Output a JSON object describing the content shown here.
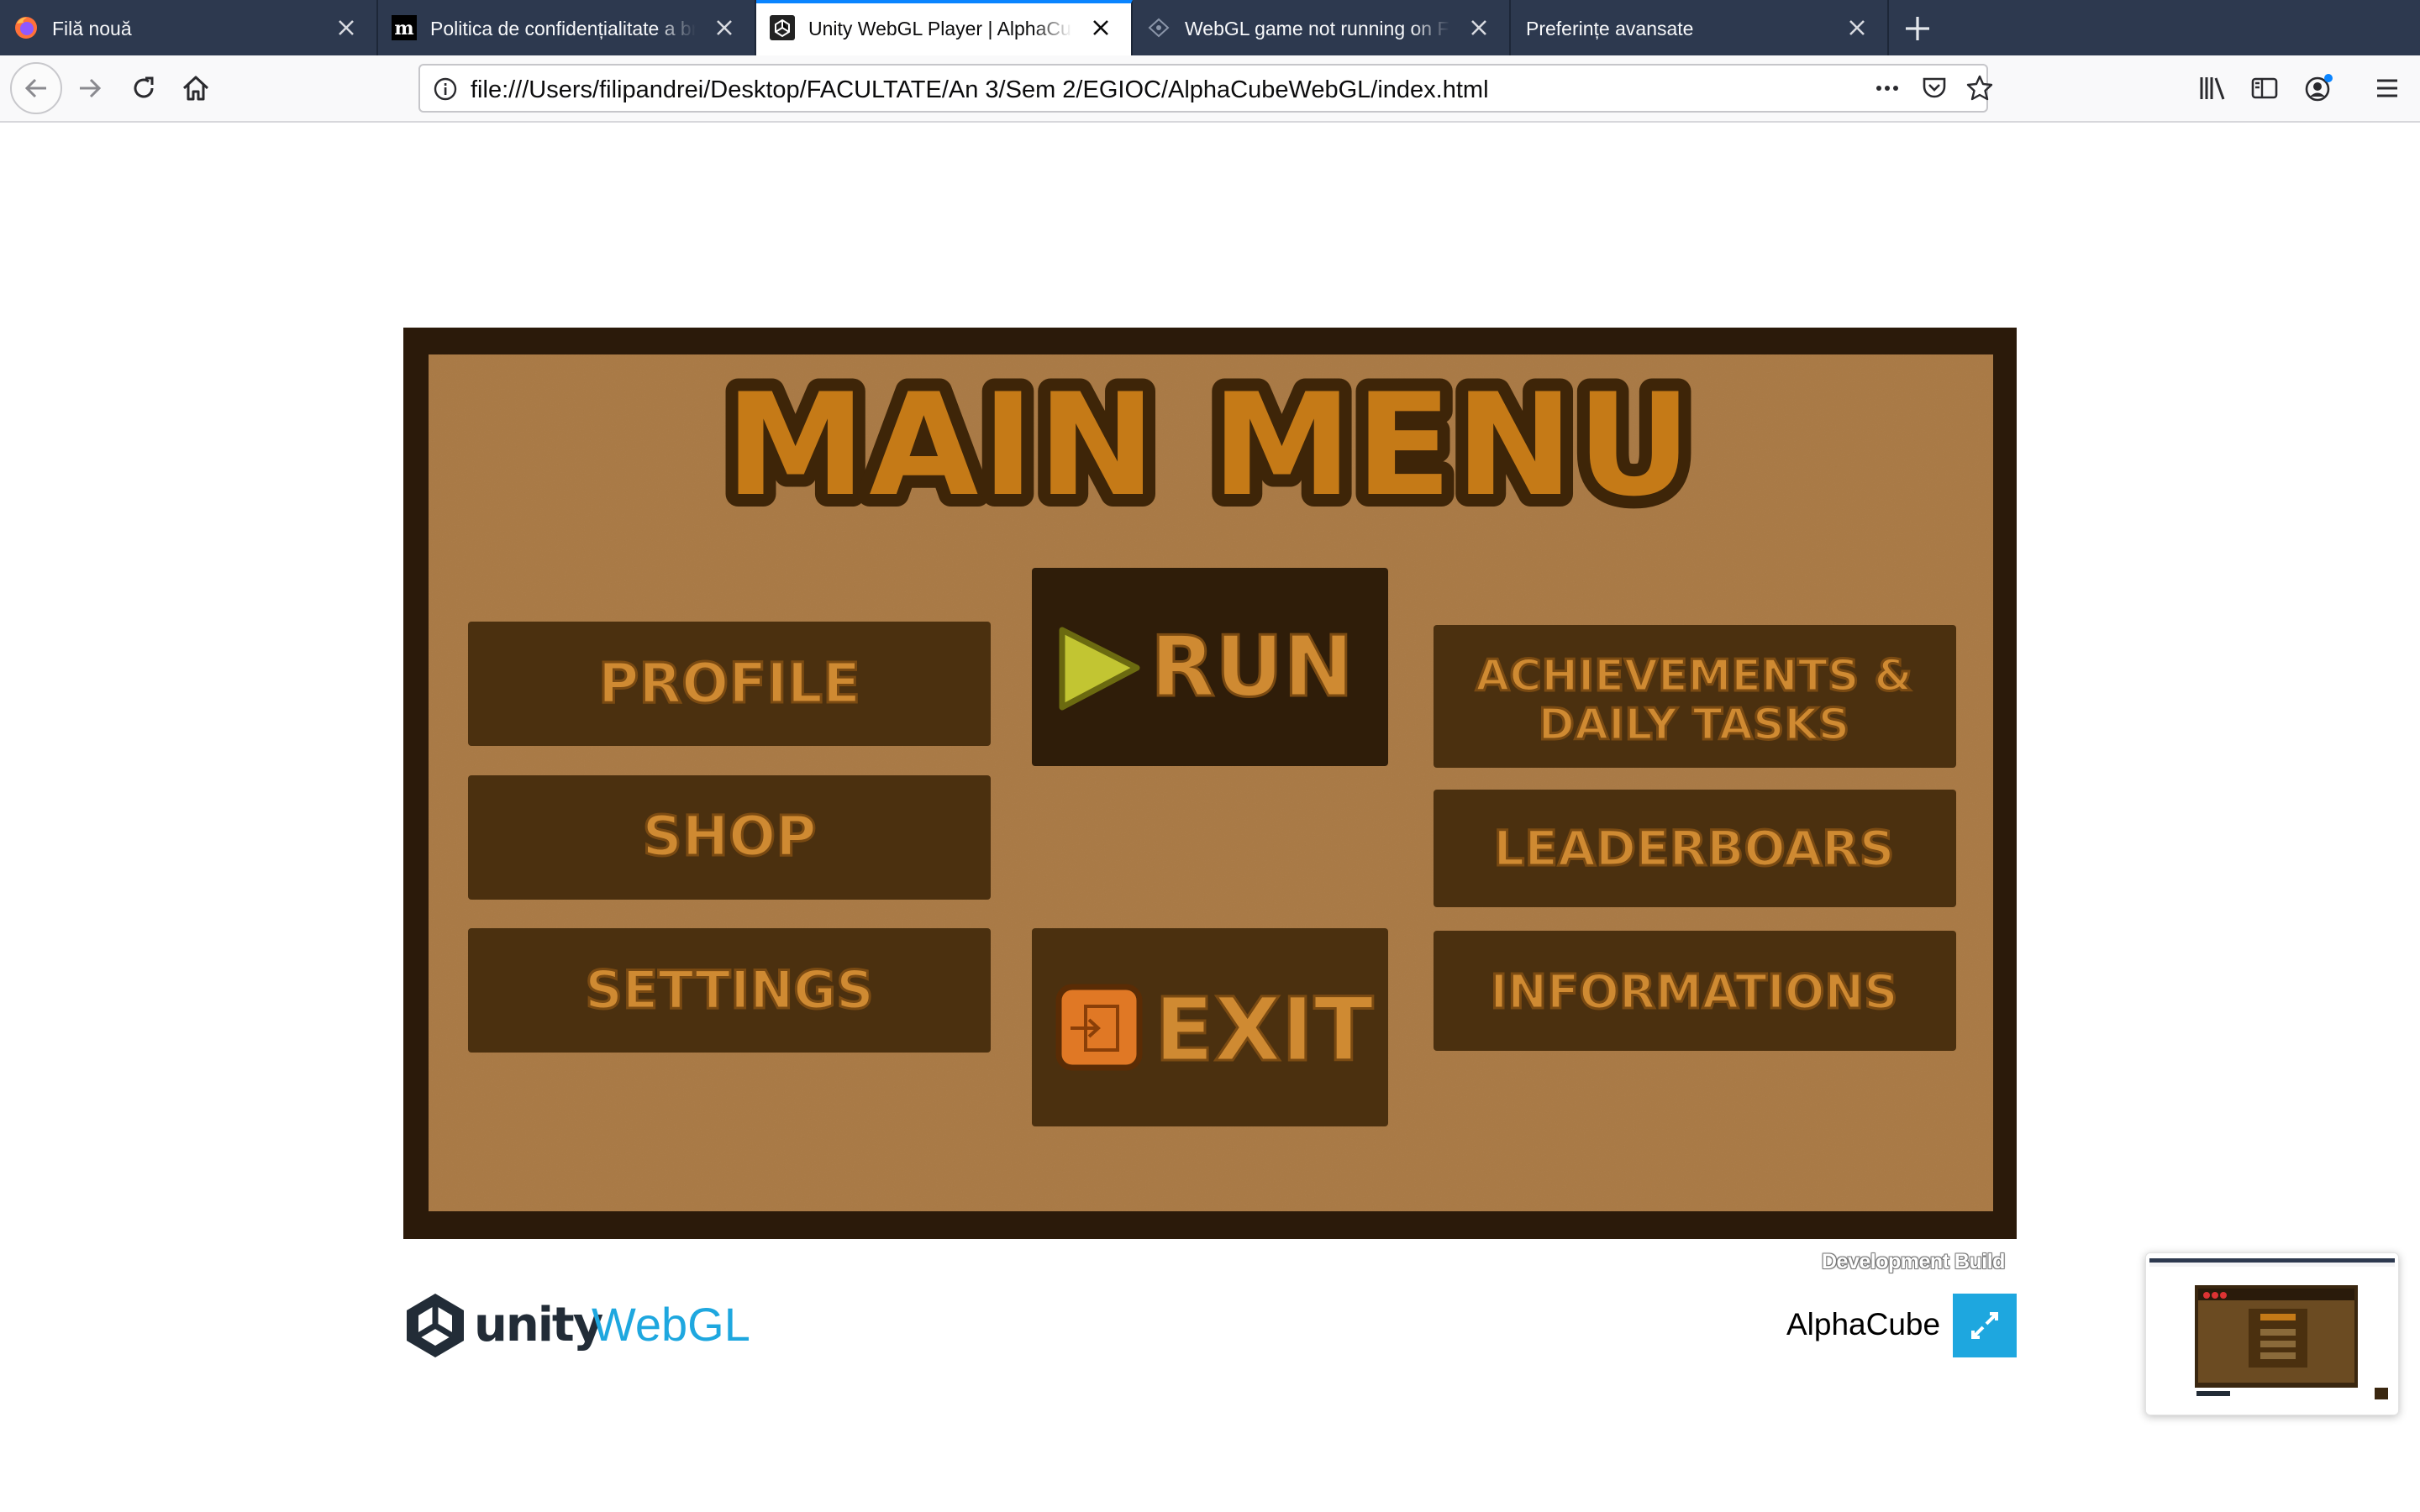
{
  "browser": {
    "tabs": [
      {
        "title": "Filă nouă",
        "icon": "firefox-icon",
        "active": false
      },
      {
        "title": "Politica de confidențialitate a browserului",
        "icon": "mozilla-m-icon",
        "active": false
      },
      {
        "title": "Unity WebGL Player | AlphaCube",
        "icon": "unity-icon",
        "active": true
      },
      {
        "title": "WebGL game not running on Firefox",
        "icon": "webgl-icon",
        "active": false
      },
      {
        "title": "Preferințe avansate",
        "icon": "",
        "active": false
      }
    ],
    "url": "file:///Users/filipandrei/Desktop/FACULTATE/An 3/Sem 2/EGIOC/AlphaCubeWebGL/index.html",
    "accent_color": "#0a84ff"
  },
  "game": {
    "menu_title": "MAIN MENU",
    "buttons": {
      "profile": "PROFILE",
      "shop": "SHOP",
      "settings": "SETTINGS",
      "run": "RUN",
      "exit": "EXIT",
      "achievements_line1": "ACHIEVEMENTS &",
      "achievements_line2": "DAILY TASKS",
      "leaderboards": "LEADERBOARS",
      "informations": "INFORMATIONS"
    },
    "colors": {
      "frame": "#2b1a0a",
      "panel": "#a97944",
      "button": "#4b300f",
      "button_active": "#2f1d09",
      "label": "#cf8a32",
      "title": "#c57a17",
      "play_icon": "#c2c532",
      "exit_icon": "#e07825"
    }
  },
  "footer": {
    "dev_build": "Development Build",
    "unity_word": "unity",
    "webgl_word": "WebGL",
    "game_title": "AlphaCube",
    "fullscreen_color": "#1ea7df"
  }
}
